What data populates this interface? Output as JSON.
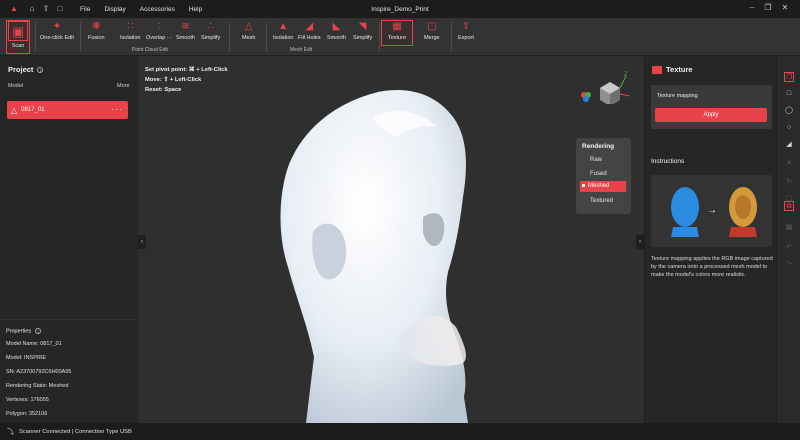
{
  "titlebar": {
    "window_title": "Inspire_Demo_Print",
    "menu": [
      "File",
      "Display",
      "Accessories",
      "Help"
    ],
    "icons": [
      "logo-icon",
      "home-icon",
      "upload-icon",
      "folder-icon"
    ],
    "window_controls": [
      "minimize-icon",
      "restore-icon",
      "maximize-icon",
      "close-icon"
    ]
  },
  "toolbar": {
    "scan_label": "Scan",
    "one_click_edit_label": "One-click Edit",
    "point_cloud_tools": [
      "Fusion",
      "Isolation",
      "Overlap ···",
      "Smooth",
      "Simplify"
    ],
    "point_cloud_group": "Point Cloud Edit",
    "mesh_tools": [
      "Mesh",
      "Isolation",
      "Fill Holes",
      "Smooth",
      "Simplify"
    ],
    "mesh_group": "Mesh Edit",
    "texture_label": "Texture",
    "merge_label": "Merge",
    "export_label": "Export"
  },
  "left_panel": {
    "title": "Project",
    "col_model": "Model",
    "col_more": "More",
    "model_item": "0817_01",
    "model_more": "···"
  },
  "properties": {
    "title": "Properties",
    "rows": [
      "Model Name:  0817_01",
      "Model:  INSPIRE",
      "SN:  A23700792C6H00A95",
      "Rendering State:  Meshed",
      "Vertexes:  176055",
      "Polygon:  352106"
    ]
  },
  "viewport": {
    "hints": [
      "Set pivot point:  ⌘ + Left-Click",
      "Move:  ⇧ + Left-Click",
      "Reset:  Space"
    ],
    "rendering_title": "Rendering",
    "rendering_options": [
      "Raw",
      "Fused",
      "Meshed",
      "Textured"
    ],
    "rendering_selected": "Meshed",
    "axis_labels": {
      "z": "Z",
      "x": "X"
    }
  },
  "right_panel": {
    "title": "Texture",
    "texture_mapping_label": "Texture mapping",
    "apply_label": "Apply",
    "instructions_title": "Instructions",
    "instructions_text": "Texture mapping applies the RGB image captured by the camera onto a processed mesh model to make the model's colors more realistic."
  },
  "status": {
    "text": "Scanner Connected | Connection Type USB"
  },
  "colors": {
    "accent": "#e8434a",
    "background": "#2b2b2b",
    "panel": "#262626"
  }
}
